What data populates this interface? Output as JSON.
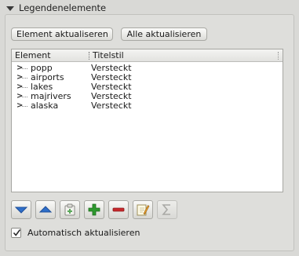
{
  "panel": {
    "title": "Legendenelemente"
  },
  "actions": {
    "update_label": "Element aktualiseren",
    "update_all_label": "Alle aktualisieren"
  },
  "tree": {
    "columns": [
      "Element",
      "Titelstil"
    ],
    "rows": [
      {
        "name": "popp",
        "style": "Versteckt"
      },
      {
        "name": "airports",
        "style": "Versteckt"
      },
      {
        "name": "lakes",
        "style": "Versteckt"
      },
      {
        "name": "majrivers",
        "style": "Versteckt"
      },
      {
        "name": "alaska",
        "style": "Versteckt"
      }
    ]
  },
  "toolbar": {
    "buttons": [
      {
        "icon": "move-down-icon",
        "enabled": true
      },
      {
        "icon": "move-up-icon",
        "enabled": true
      },
      {
        "icon": "add-group-icon",
        "enabled": true
      },
      {
        "icon": "add-icon",
        "enabled": true
      },
      {
        "icon": "remove-icon",
        "enabled": true
      },
      {
        "icon": "edit-icon",
        "enabled": true
      },
      {
        "icon": "sum-icon",
        "enabled": false
      }
    ]
  },
  "auto_update": {
    "label": "Automatisch aktualisieren",
    "checked": true
  },
  "colors": {
    "arrow_blue": "#2f6fc9",
    "add_green": "#2e9a2e",
    "remove_red": "#c8282b"
  }
}
